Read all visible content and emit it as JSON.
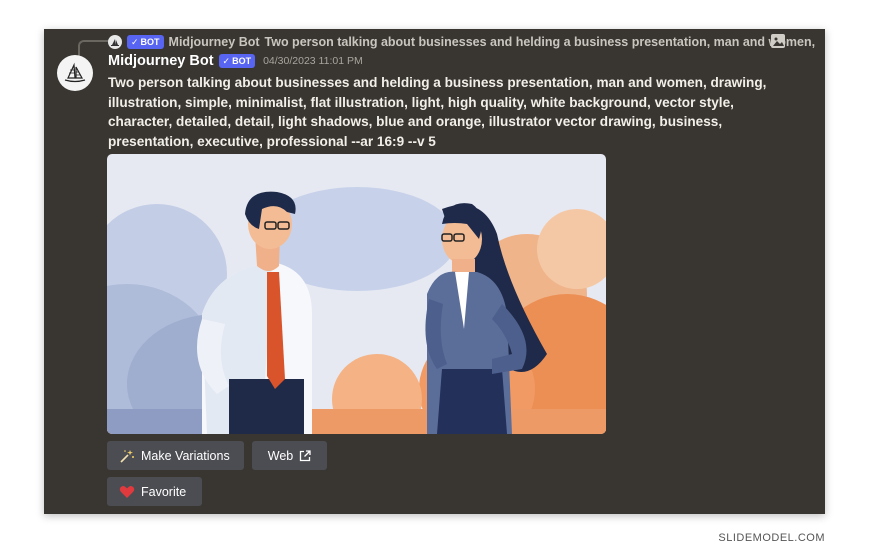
{
  "reply": {
    "badge": "BOT",
    "name": "Midjourney Bot",
    "preview": "Two person talking about businesses and helding a business presentation, man and women,"
  },
  "message": {
    "username": "Midjourney Bot",
    "badge": "BOT",
    "timestamp": "04/30/2023 11:01 PM",
    "prompt": "Two person talking about businesses and helding a business presentation, man and women, drawing, illustration, simple, minimalist, flat illustration, light, high quality, white background, vector style, character, detailed, detail, light shadows, blue and orange, illustrator vector drawing, business, presentation, executive, professional --ar 16:9 --v 5"
  },
  "buttons": {
    "variations": "Make Variations",
    "web": "Web",
    "favorite": "Favorite"
  },
  "icons": {
    "variations": "sparkle-wand-icon",
    "web": "external-link-icon",
    "favorite": "heart-icon",
    "image": "image-icon",
    "avatar": "sailboat-logo-icon"
  },
  "watermark": "SLIDEMODEL.COM",
  "colors": {
    "panel": "#393631",
    "badge": "#5865f2",
    "button": "#4c4d52",
    "heart": "#e03a3e"
  }
}
